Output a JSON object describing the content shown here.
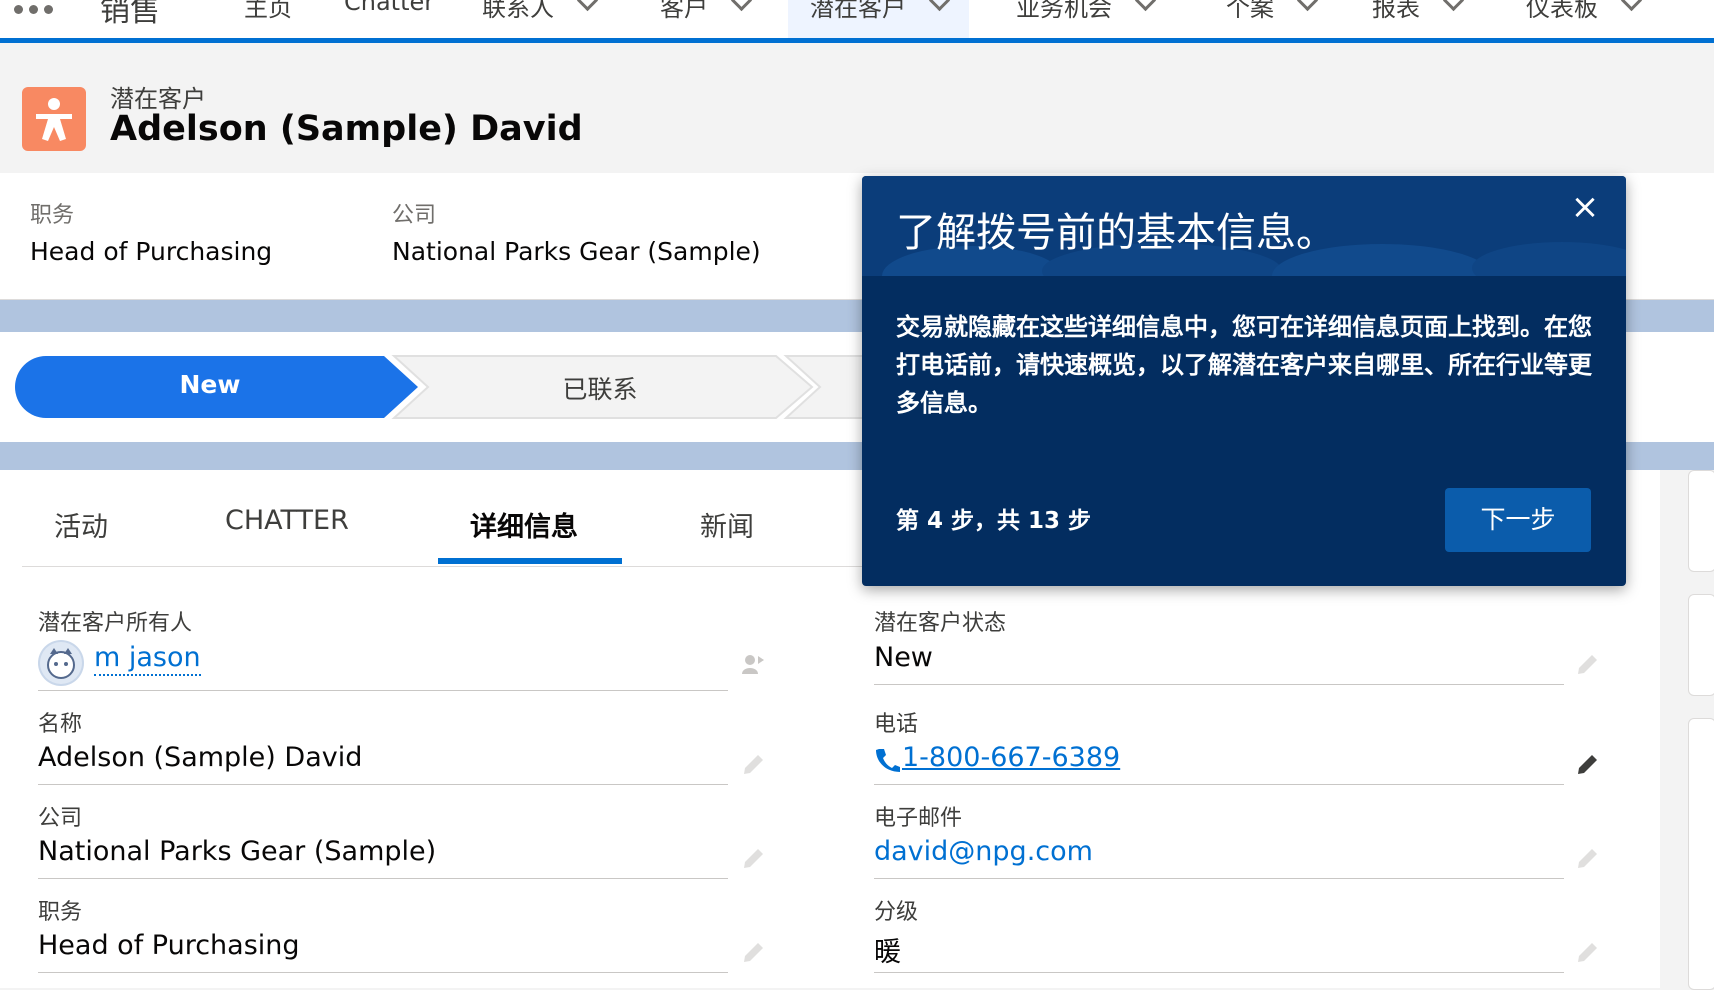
{
  "nav": {
    "app_name": "销售",
    "items": [
      {
        "label": "主页",
        "has_menu": false
      },
      {
        "label": "Chatter",
        "has_menu": false
      },
      {
        "label": "联系人",
        "has_menu": true
      },
      {
        "label": "客户",
        "has_menu": true
      },
      {
        "label": "潜在客户",
        "has_menu": true,
        "active": true
      },
      {
        "label": "业务机会",
        "has_menu": true
      },
      {
        "label": "个案",
        "has_menu": true
      },
      {
        "label": "报表",
        "has_menu": true
      },
      {
        "label": "仪表板",
        "has_menu": true
      }
    ]
  },
  "header": {
    "object_type": "潜在客户",
    "record_name": "Adelson (Sample) David",
    "icon": "lead-person-icon",
    "icon_color": "#f88962"
  },
  "highlights": [
    {
      "label": "职务",
      "value": "Head of Purchasing"
    },
    {
      "label": "公司",
      "value": "National Parks Gear (Sample)"
    }
  ],
  "path": {
    "steps": [
      {
        "label": "New",
        "current": true
      },
      {
        "label": "已联系",
        "current": false
      }
    ]
  },
  "tabs": [
    {
      "label": "活动"
    },
    {
      "label": "CHATTER"
    },
    {
      "label": "详细信息",
      "active": true
    },
    {
      "label": "新闻"
    }
  ],
  "fields_left": [
    {
      "label": "潜在客户所有人",
      "value": "m jason",
      "type": "owner"
    },
    {
      "label": "名称",
      "value": "Adelson (Sample) David"
    },
    {
      "label": "公司",
      "value": "National Parks Gear (Sample)"
    },
    {
      "label": "职务",
      "value": "Head of Purchasing"
    }
  ],
  "fields_right": [
    {
      "label": "潜在客户状态",
      "value": "New"
    },
    {
      "label": "电话",
      "value": "1-800-667-6389",
      "type": "phone"
    },
    {
      "label": "电子邮件",
      "value": "david@npg.com",
      "type": "email"
    },
    {
      "label": "分级",
      "value": "暖"
    }
  ],
  "popover": {
    "title": "了解拨号前的基本信息。",
    "body": "交易就隐藏在这些详细信息中，您可在详细信息页面上找到。在您打电话前，请快速概览，以了解潜在客户来自哪里、所在行业等更多信息。",
    "step_text": "第 4 步，共 13 步",
    "next_label": "下一步",
    "close_symbol": "×"
  },
  "colors": {
    "brand": "#0070d2",
    "popover_bg": "#032d60",
    "lead_icon": "#f88962"
  }
}
